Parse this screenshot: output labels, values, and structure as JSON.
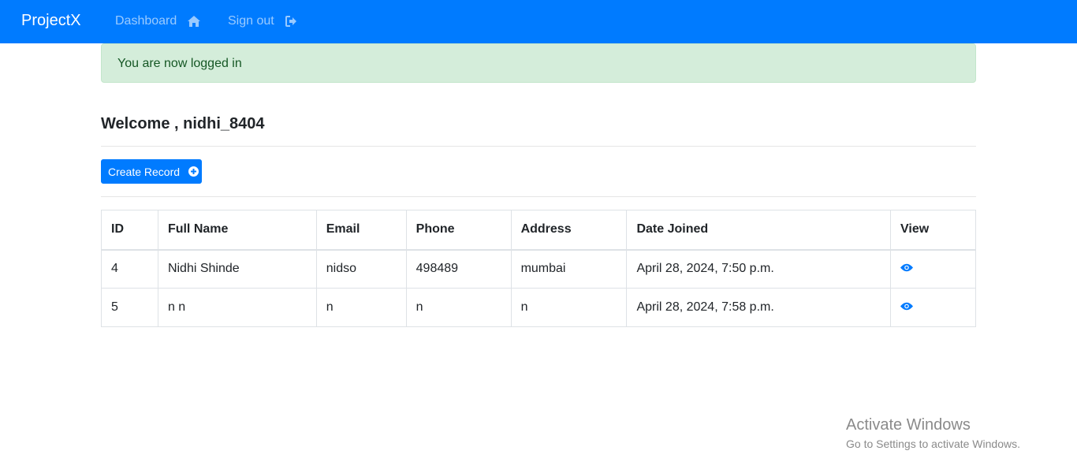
{
  "navbar": {
    "brand": "ProjectX",
    "dashboard_label": "Dashboard",
    "signout_label": "Sign out",
    "dashboard_icon": "home-icon",
    "signout_icon": "sign-out-icon",
    "bg_color": "#007bff"
  },
  "alert": {
    "message": "You are now logged in",
    "bg_color": "#d4edda"
  },
  "welcome": {
    "heading": "Welcome , nidhi_8404"
  },
  "create_button": {
    "label": "Create Record",
    "icon": "plus-circle-icon"
  },
  "table": {
    "headers": [
      "ID",
      "Full Name",
      "Email",
      "Phone",
      "Address",
      "Date Joined",
      "View"
    ],
    "rows": [
      {
        "id": "4",
        "full_name": "Nidhi Shinde",
        "email": "nidso",
        "phone": "498489",
        "address": "mumbai",
        "date_joined": "April 28, 2024, 7:50 p.m.",
        "view_icon": "eye-icon"
      },
      {
        "id": "5",
        "full_name": "n n",
        "email": "n",
        "phone": "n",
        "address": "n",
        "date_joined": "April 28, 2024, 7:58 p.m.",
        "view_icon": "eye-icon"
      }
    ]
  },
  "watermark": {
    "line1": "Activate Windows",
    "line2": "Go to Settings to activate Windows."
  }
}
